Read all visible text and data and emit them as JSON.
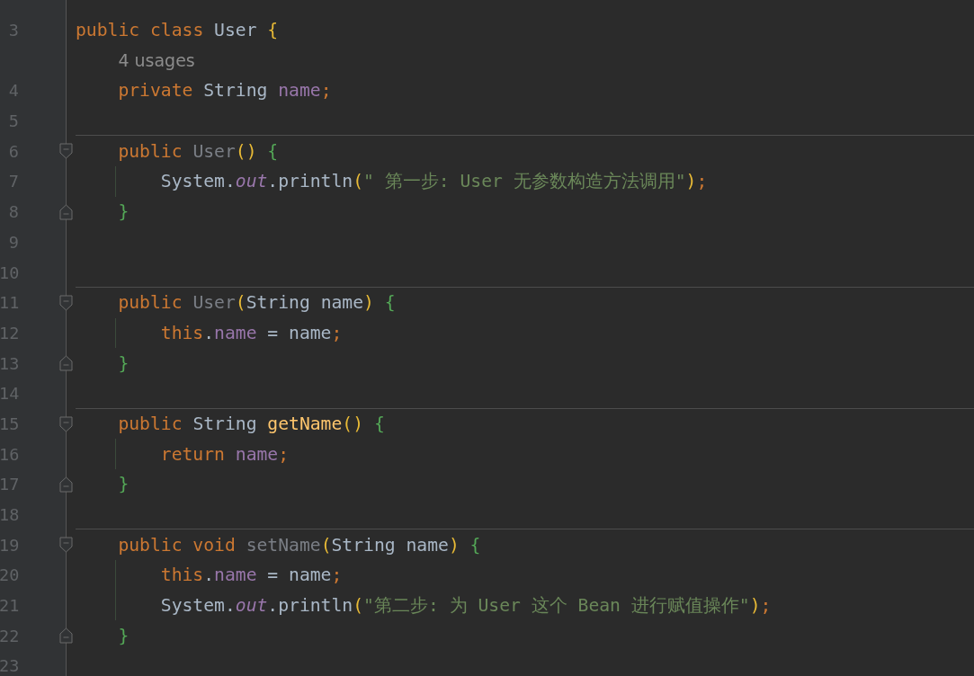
{
  "editor": {
    "lines": [
      {
        "number": "3",
        "tokens": [
          {
            "kind": "keyword",
            "text": "public class "
          },
          {
            "kind": "plain",
            "text": "User "
          },
          {
            "kind": "paren",
            "text": "{"
          }
        ],
        "children": [
          {
            "tokens": [
              {
                "kind": "hint",
                "text": "4 usages"
              }
            ]
          },
          {
            "number": "4",
            "tokens": [
              {
                "kind": "keyword",
                "text": "private "
              },
              {
                "kind": "plain",
                "text": "String "
              },
              {
                "kind": "field",
                "text": "name"
              },
              {
                "kind": "semicolon",
                "text": ";"
              }
            ]
          },
          {
            "number": "5"
          },
          {
            "number": "6",
            "separator": true,
            "fold_start": true,
            "tokens": [
              {
                "kind": "keyword",
                "text": "public "
              },
              {
                "kind": "unused",
                "text": "User"
              },
              {
                "kind": "paren",
                "text": "() "
              },
              {
                "kind": "brace",
                "text": "{"
              }
            ],
            "children": [
              {
                "number": "7",
                "tokens": [
                  {
                    "kind": "plain",
                    "text": "System."
                  },
                  {
                    "kind": "static",
                    "text": "out"
                  },
                  {
                    "kind": "plain",
                    "text": ".println"
                  },
                  {
                    "kind": "paren",
                    "text": "("
                  },
                  {
                    "kind": "string",
                    "text": "\" 第一步: User 无参数构造方法调用\""
                  },
                  {
                    "kind": "paren",
                    "text": ")"
                  },
                  {
                    "kind": "semicolon",
                    "text": ";"
                  }
                ]
              }
            ]
          },
          {
            "number": "8",
            "fold_end": true,
            "tokens": [
              {
                "kind": "brace",
                "text": "}"
              }
            ]
          },
          {
            "number": "9"
          },
          {
            "number": "10"
          },
          {
            "number": "11",
            "separator": true,
            "fold_start": true,
            "tokens": [
              {
                "kind": "keyword",
                "text": "public "
              },
              {
                "kind": "unused",
                "text": "User"
              },
              {
                "kind": "paren",
                "text": "("
              },
              {
                "kind": "plain",
                "text": "String name"
              },
              {
                "kind": "paren",
                "text": ") "
              },
              {
                "kind": "brace",
                "text": "{"
              }
            ],
            "children": [
              {
                "number": "12",
                "tokens": [
                  {
                    "kind": "keyword",
                    "text": "this"
                  },
                  {
                    "kind": "plain",
                    "text": "."
                  },
                  {
                    "kind": "field",
                    "text": "name"
                  },
                  {
                    "kind": "plain",
                    "text": " = name"
                  },
                  {
                    "kind": "semicolon",
                    "text": ";"
                  }
                ]
              }
            ]
          },
          {
            "number": "13",
            "fold_end": true,
            "tokens": [
              {
                "kind": "brace",
                "text": "}"
              }
            ]
          },
          {
            "number": "14"
          },
          {
            "number": "15",
            "separator": true,
            "fold_start": true,
            "tokens": [
              {
                "kind": "keyword",
                "text": "public "
              },
              {
                "kind": "plain",
                "text": "String "
              },
              {
                "kind": "method",
                "text": "getName"
              },
              {
                "kind": "paren",
                "text": "() "
              },
              {
                "kind": "brace",
                "text": "{"
              }
            ],
            "children": [
              {
                "number": "16",
                "tokens": [
                  {
                    "kind": "keyword",
                    "text": "return "
                  },
                  {
                    "kind": "field",
                    "text": "name"
                  },
                  {
                    "kind": "semicolon",
                    "text": ";"
                  }
                ]
              }
            ]
          },
          {
            "number": "17",
            "fold_end": true,
            "tokens": [
              {
                "kind": "brace",
                "text": "}"
              }
            ]
          },
          {
            "number": "18"
          },
          {
            "number": "19",
            "separator": true,
            "fold_start": true,
            "tokens": [
              {
                "kind": "keyword",
                "text": "public void "
              },
              {
                "kind": "unused",
                "text": "setName"
              },
              {
                "kind": "paren",
                "text": "("
              },
              {
                "kind": "plain",
                "text": "String name"
              },
              {
                "kind": "paren",
                "text": ") "
              },
              {
                "kind": "brace",
                "text": "{"
              }
            ],
            "children": [
              {
                "number": "20",
                "tokens": [
                  {
                    "kind": "keyword",
                    "text": "this"
                  },
                  {
                    "kind": "plain",
                    "text": "."
                  },
                  {
                    "kind": "field",
                    "text": "name"
                  },
                  {
                    "kind": "plain",
                    "text": " = name"
                  },
                  {
                    "kind": "semicolon",
                    "text": ";"
                  }
                ]
              },
              {
                "number": "21",
                "tokens": [
                  {
                    "kind": "plain",
                    "text": "System."
                  },
                  {
                    "kind": "static",
                    "text": "out"
                  },
                  {
                    "kind": "plain",
                    "text": ".println"
                  },
                  {
                    "kind": "paren",
                    "text": "("
                  },
                  {
                    "kind": "string",
                    "text": "\"第二步: 为 User 这个 Bean 进行赋值操作\""
                  },
                  {
                    "kind": "paren",
                    "text": ")"
                  },
                  {
                    "kind": "semicolon",
                    "text": ";"
                  }
                ]
              }
            ]
          },
          {
            "number": "22",
            "fold_end": true,
            "tokens": [
              {
                "kind": "brace",
                "text": "}"
              }
            ]
          }
        ]
      },
      {
        "number": "23"
      }
    ]
  }
}
